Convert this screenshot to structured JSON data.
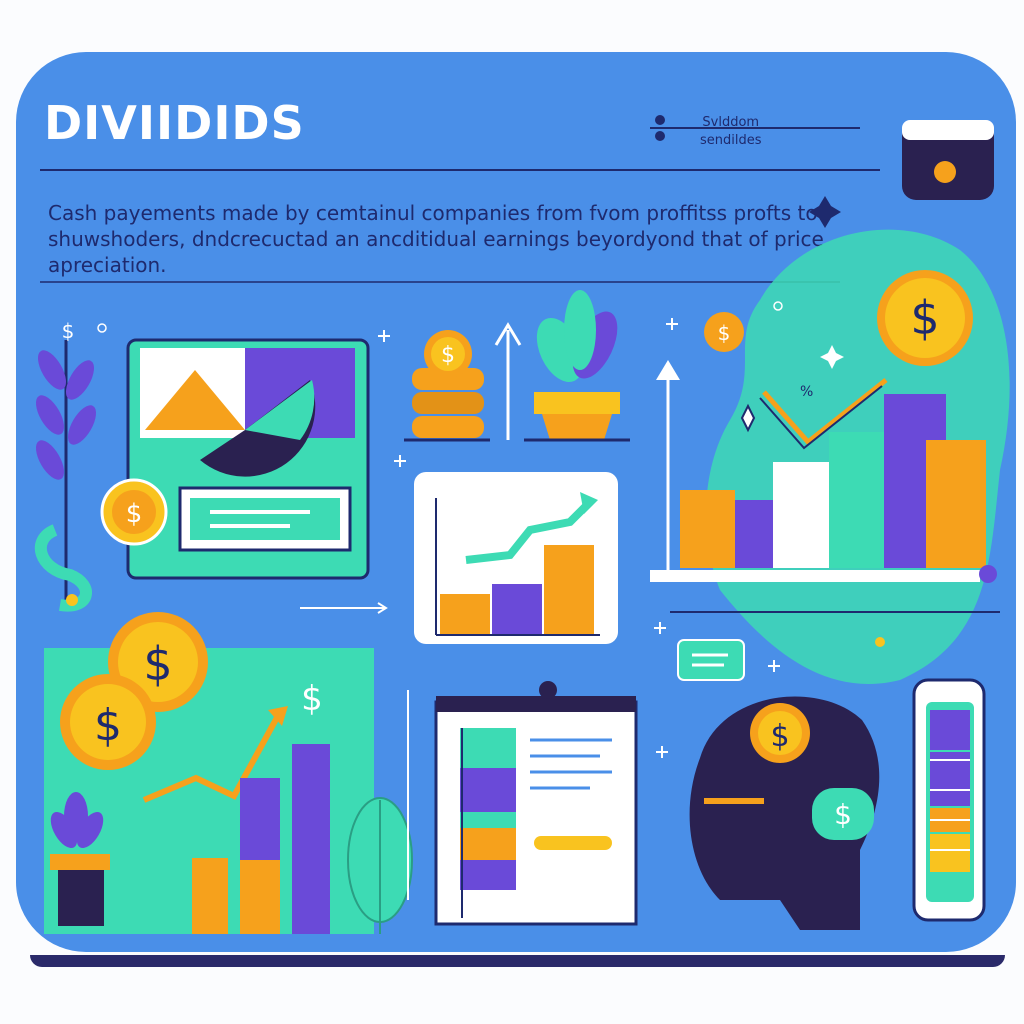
{
  "header": {
    "title": "DIVIIDIDS",
    "subtitle_line1": "Svlddom",
    "subtitle_line2": "sendildes"
  },
  "description": "Cash payements made by cemtainul companies from fvom proffitss profts to shuwshoders, dndcrecuctad an ancditidual earnings beyordyond that of price apreciation.",
  "icons": {
    "currency": "dollar-sign",
    "symbols": [
      "wallet-icon",
      "coin-icon",
      "plant-icon",
      "leaf-icon",
      "arrow-up-icon",
      "trend-arrow-icon",
      "sparkle-icon",
      "plus-icon",
      "document-icon",
      "phone-icon",
      "head-icon",
      "bar-chart-icon"
    ]
  },
  "colors": {
    "background": "#4a8fe8",
    "teal": "#3ddbb4",
    "purple": "#6a4ad8",
    "orange": "#f6a11c",
    "gold": "#f9c31f",
    "navy": "#1e2a6e",
    "dark": "#2a2150"
  },
  "glyphs": {
    "dollar": "$",
    "percent": "%"
  }
}
